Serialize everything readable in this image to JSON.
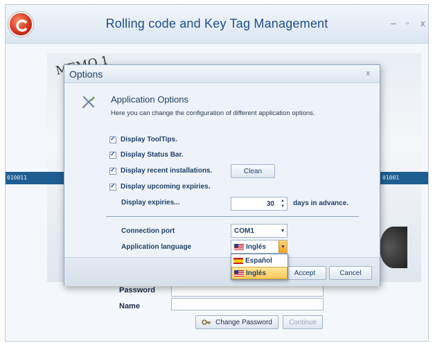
{
  "app": {
    "title": "Rolling code and Key Tag Management",
    "minimize": "–",
    "maximize": "▫",
    "close": "x"
  },
  "background": {
    "memo_text": "MEMO 1",
    "bits_left": "010011",
    "bits_right": "01001",
    "login": {
      "password_label": "Password",
      "name_label": "Name",
      "change_password_label": "Change Password",
      "continue_label": "Continue"
    }
  },
  "dialog": {
    "title": "Options",
    "close": "x",
    "heading": "Application Options",
    "description": "Here you can change the configuration of different application options.",
    "checkboxes": [
      {
        "label": "Display ToolTips.",
        "checked": true
      },
      {
        "label": "Display Status Bar.",
        "checked": true
      },
      {
        "label": "Display recent installations.",
        "checked": true
      },
      {
        "label": "Display upcoming expiries.",
        "checked": true
      }
    ],
    "clean_label": "Clean",
    "expiries_label": "Display expiries...",
    "expiries_value": "30",
    "days_label": "days in advance.",
    "connection_port_label": "Connection port",
    "connection_port_value": "COM1",
    "language_label": "Application language",
    "language_value": "Inglés",
    "language_options": [
      "Español",
      "Inglés"
    ],
    "language_selected_index": 1,
    "accept_label": "Accept",
    "cancel_label": "Cancel"
  },
  "colors": {
    "title_text": "#1f4e8c",
    "dialog_text": "#1f3f66",
    "selection": "#fcc95a",
    "accent_orange": "#f6a21a"
  }
}
